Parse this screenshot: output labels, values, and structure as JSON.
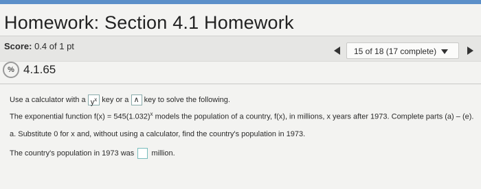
{
  "header": {
    "title": "Homework: Section 4.1 Homework"
  },
  "score": {
    "label": "Score:",
    "value": "0.4 of 1 pt"
  },
  "nav": {
    "progress": "15 of 18 (17 complete)"
  },
  "question": {
    "id": "4.1.65",
    "status_icon": "partial-credit-icon"
  },
  "content": {
    "line1_a": "Use a calculator with a",
    "key1": "y",
    "key1_sup": "x",
    "line1_b": "key or a",
    "key2": "∧",
    "line1_c": "key to solve the following.",
    "line2_a": "The exponential function f(x) = 545(1.032)",
    "line2_sup": "x",
    "line2_b": " models the population of a country, f(x), in millions, x years after 1973. Complete parts (a) – (e).",
    "line3": "a. Substitute 0 for x and, without using a calculator, find the country's population in 1973.",
    "line4_a": "The country's population in 1973 was",
    "line4_b": "million."
  },
  "colors": {
    "accent": "#5b8fc9"
  }
}
